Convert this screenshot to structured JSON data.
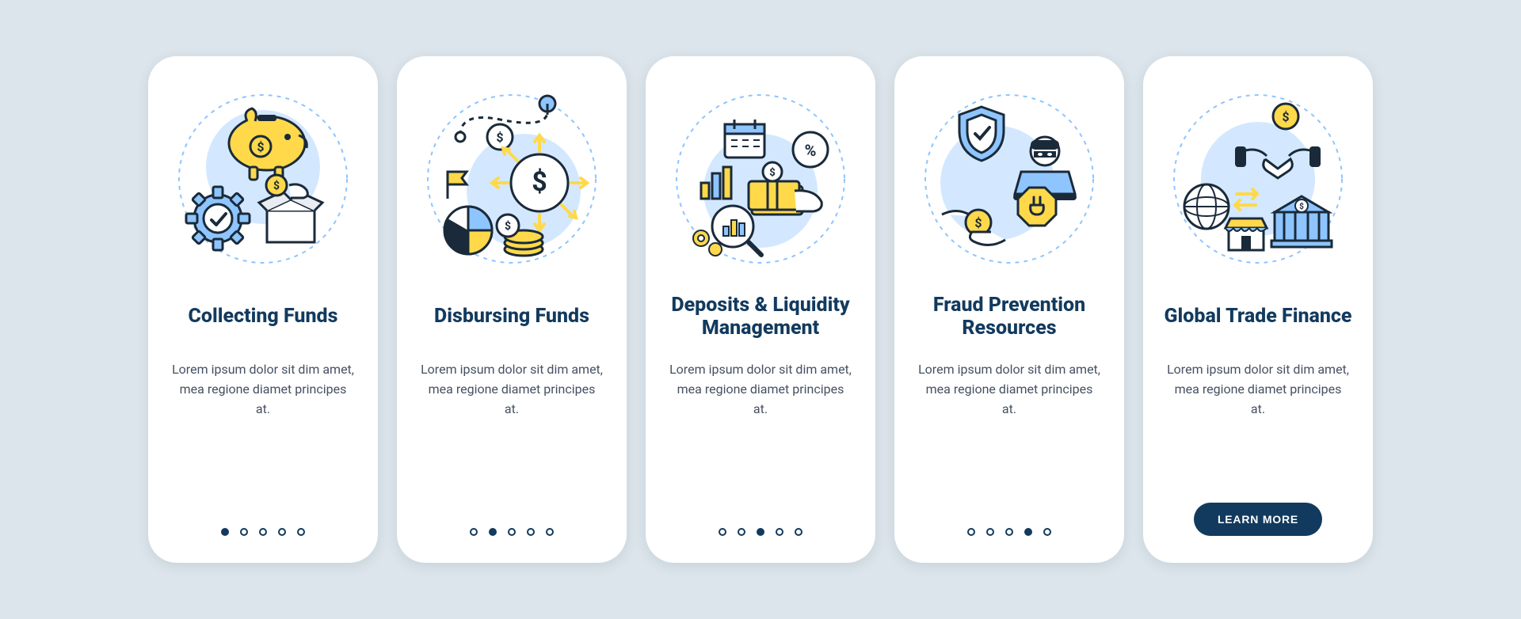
{
  "colors": {
    "navy": "#123a5e",
    "yellow": "#ffd94a",
    "blue": "#8ec5ff",
    "lightblue": "#d3e8ff",
    "darkstroke": "#1a2a3a"
  },
  "cards": [
    {
      "icon": "collecting-funds-icon",
      "title": "Collecting Funds",
      "desc": "Lorem ipsum dolor sit dim amet, mea regione diamet principes at.",
      "activeDot": 0,
      "showDots": true
    },
    {
      "icon": "disbursing-funds-icon",
      "title": "Disbursing Funds",
      "desc": "Lorem ipsum dolor sit dim amet, mea regione diamet principes at.",
      "activeDot": 1,
      "showDots": true
    },
    {
      "icon": "deposits-liquidity-icon",
      "title": "Deposits & Liquidity Management",
      "desc": "Lorem ipsum dolor sit dim amet, mea regione diamet principes at.",
      "activeDot": 2,
      "showDots": true
    },
    {
      "icon": "fraud-prevention-icon",
      "title": "Fraud Prevention Resources",
      "desc": "Lorem ipsum dolor sit dim amet, mea regione diamet principes at.",
      "activeDot": 3,
      "showDots": true
    },
    {
      "icon": "global-trade-icon",
      "title": "Global Trade Finance",
      "desc": "Lorem ipsum dolor sit dim amet, mea regione diamet principes at.",
      "activeDot": 4,
      "showDots": false,
      "button": "LEARN MORE"
    }
  ],
  "dotsCount": 5
}
